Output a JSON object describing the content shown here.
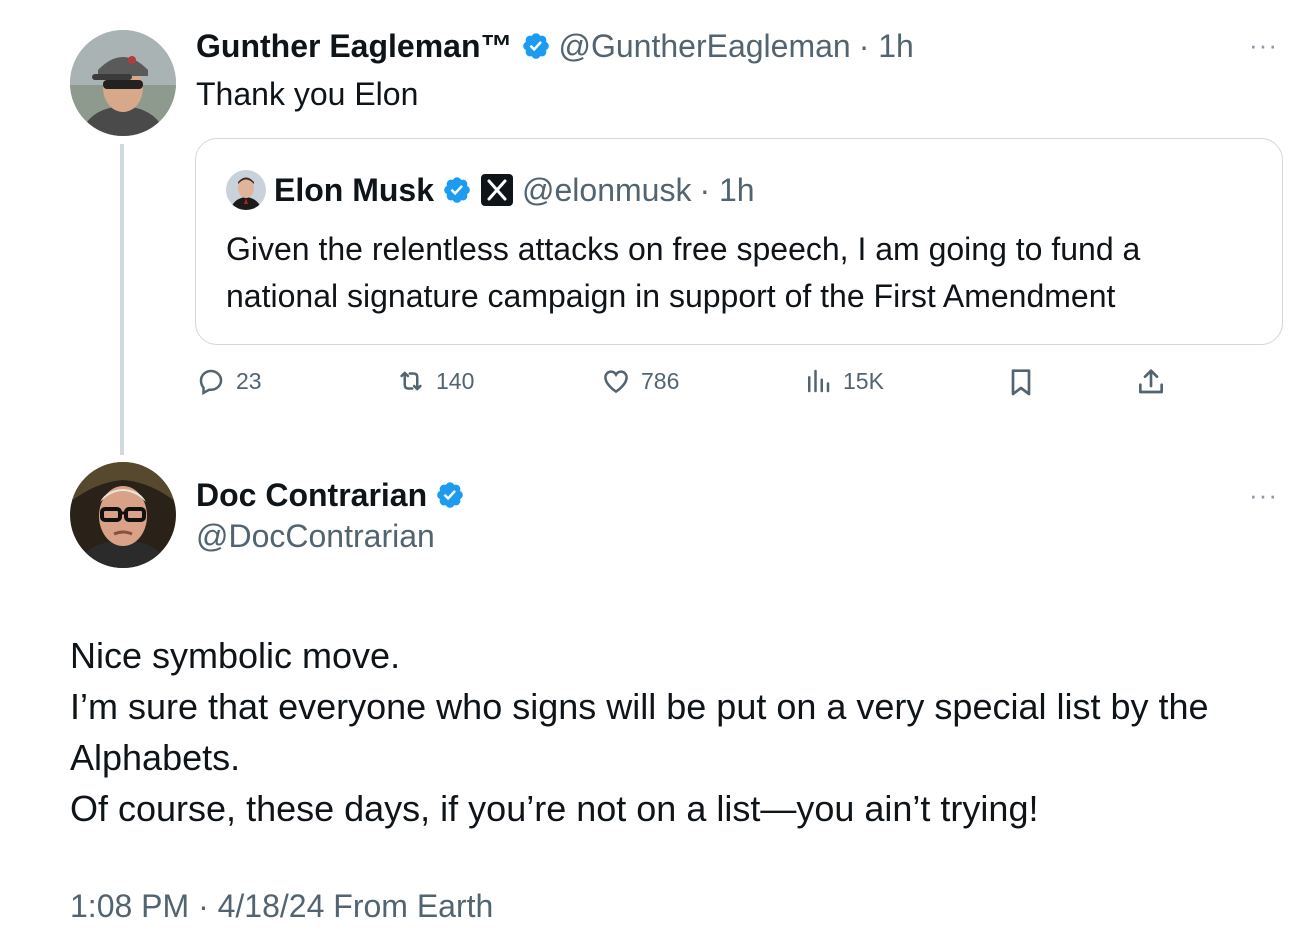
{
  "reply_parent": {
    "display_name": "Gunther Eagleman™",
    "handle": "@GuntherEagleman",
    "time": "· 1h",
    "text": "Thank you Elon",
    "more": "···",
    "quoted": {
      "display_name": "Elon Musk",
      "handle": "@elonmusk",
      "time": "· 1h",
      "text": "Given the relentless attacks on free speech, I am going to fund a national signature campaign in support of the First Amendment"
    },
    "actions": {
      "replies": "23",
      "reposts": "140",
      "likes": "786",
      "views": "15K"
    }
  },
  "main_tweet": {
    "display_name": "Doc Contrarian",
    "handle": "@DocContrarian",
    "more": "···",
    "lines": [
      "Nice symbolic move.",
      "I’m sure that everyone who signs will be put on a very special list by the",
      "Alphabets.",
      "Of course, these days, if you’re not on a list—you ain’t trying!"
    ],
    "meta": "1:08 PM · 4/18/24 From Earth"
  },
  "colors": {
    "accent": "#1d9bf0",
    "muted": "#536471",
    "border": "#cfd9de"
  }
}
